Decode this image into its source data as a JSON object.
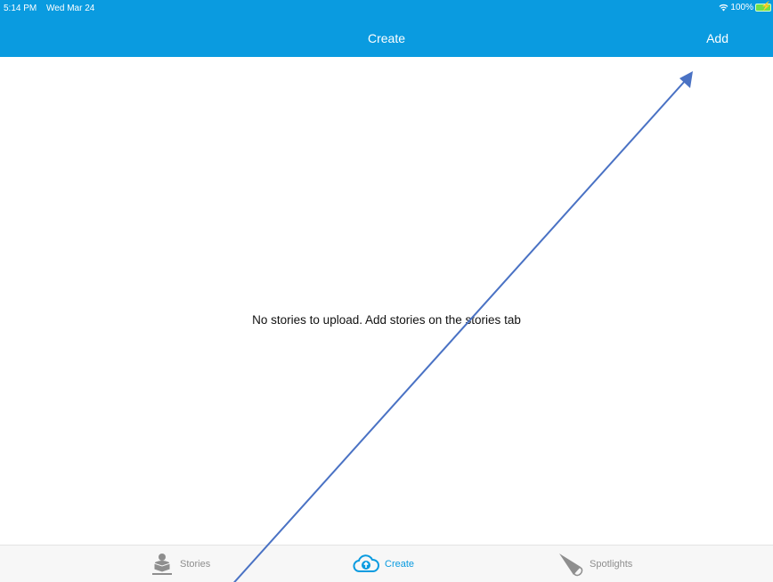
{
  "status_bar": {
    "time": "5:14 PM",
    "date": "Wed Mar 24",
    "battery": "100%"
  },
  "nav": {
    "title": "Create",
    "add_label": "Add"
  },
  "main": {
    "empty_message": "No stories to upload.  Add stories on the stories tab"
  },
  "tabs": [
    {
      "label": "Stories",
      "icon": "reader-icon",
      "active": false
    },
    {
      "label": "Create",
      "icon": "cloud-upload-icon",
      "active": true
    },
    {
      "label": "Spotlights",
      "icon": "spotlight-icon",
      "active": false
    }
  ],
  "colors": {
    "accent": "#0a9be0",
    "annotation_arrow": "#4a72c4",
    "tab_inactive": "#8e8e8e"
  }
}
